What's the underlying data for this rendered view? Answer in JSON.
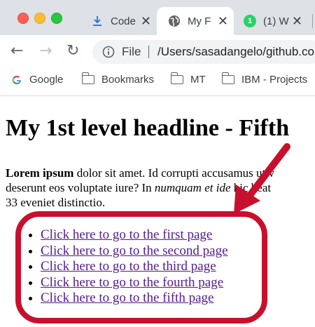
{
  "tabs": [
    {
      "label": "Code",
      "icon": "download-icon"
    },
    {
      "label": "My F",
      "icon": "globe-icon",
      "active": true
    },
    {
      "label": "(1) W",
      "icon": "whatsapp-icon",
      "badge": "1"
    }
  ],
  "toolbar": {
    "file_label": "File",
    "url": "/Users/sasadangelo/github.com/"
  },
  "bookmarks": [
    {
      "label": "Google",
      "icon": "google-icon"
    },
    {
      "label": "Bookmarks",
      "icon": "folder-icon"
    },
    {
      "label": "MT",
      "icon": "folder-icon"
    },
    {
      "label": "IBM - Projects",
      "icon": "folder-icon"
    }
  ],
  "page": {
    "headline": "My 1st level headline - Fifth",
    "para": {
      "bold": "Lorem ipsum",
      "text1": " dolor sit amet. Id corrupti accusamus ut v",
      "text2": "deserunt eos voluptate iure? In ",
      "italic": "numquam et ide",
      "text3": " hic beat",
      "text4": "33 eveniet distinctio."
    },
    "links": [
      "Click here to go to the first page",
      "Click here to go to the second page",
      "Click here to go to the third page",
      "Click here to go to the fourth page",
      "Click here to go to the fifth page"
    ]
  },
  "annotation": {
    "color": "#c8102e"
  }
}
